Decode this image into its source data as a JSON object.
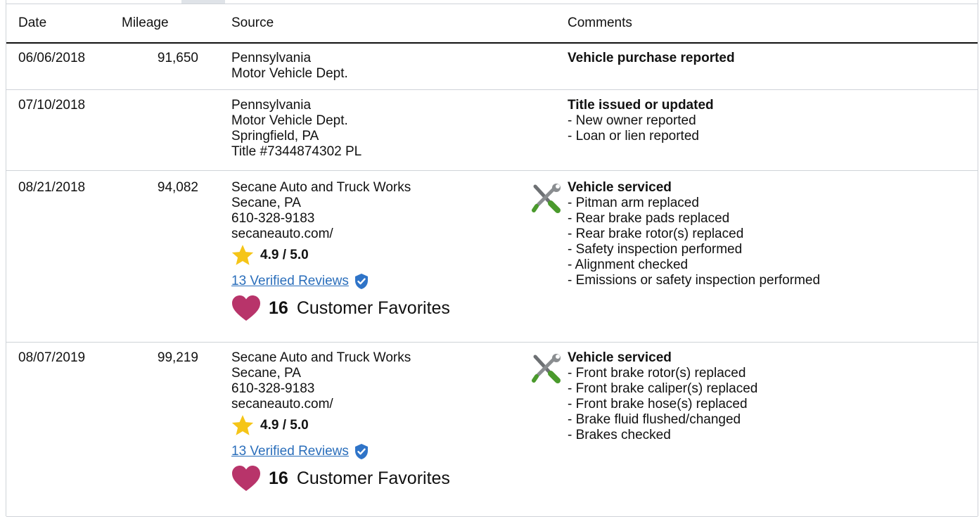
{
  "header": {
    "date": "Date",
    "mileage": "Mileage",
    "source": "Source",
    "comments": "Comments"
  },
  "rows": [
    {
      "date": "06/06/2018",
      "mileage": "91,650",
      "source": [
        "Pennsylvania",
        "Motor Vehicle Dept."
      ],
      "comment_title": "Vehicle purchase reported",
      "comment_items": []
    },
    {
      "date": "07/10/2018",
      "mileage": "",
      "source": [
        "Pennsylvania",
        "Motor Vehicle Dept.",
        "Springfield, PA",
        "Title #7344874302 PL"
      ],
      "comment_title": "Title issued or updated",
      "comment_items": [
        "- New owner reported",
        "- Loan or lien reported"
      ]
    },
    {
      "date": "08/21/2018",
      "mileage": "94,082",
      "source": [
        "Secane Auto and Truck Works",
        "Secane, PA",
        "610-328-9183",
        "secaneauto.com/"
      ],
      "rating": "4.9 / 5.0",
      "reviews": "13 Verified Reviews",
      "favorites_count": "16",
      "favorites_label": "Customer Favorites",
      "comment_title": "Vehicle serviced",
      "comment_items": [
        "- Pitman arm replaced",
        "- Rear brake pads replaced",
        "- Rear brake rotor(s) replaced",
        "- Safety inspection performed",
        "- Alignment checked",
        "- Emissions or safety inspection performed"
      ]
    },
    {
      "date": "08/07/2019",
      "mileage": "99,219",
      "source": [
        "Secane Auto and Truck Works",
        "Secane, PA",
        "610-328-9183",
        "secaneauto.com/"
      ],
      "rating": "4.9 / 5.0",
      "reviews": "13 Verified Reviews",
      "favorites_count": "16",
      "favorites_label": "Customer Favorites",
      "comment_title": "Vehicle serviced",
      "comment_items": [
        "- Front brake rotor(s) replaced",
        "- Front brake caliper(s) replaced",
        "- Front brake hose(s) replaced",
        "- Brake fluid flushed/changed",
        "- Brakes checked"
      ]
    }
  ],
  "icons": {
    "star": "star-icon",
    "verified": "verified-badge-icon",
    "heart": "heart-icon",
    "service": "wrench-screwdriver-icon"
  },
  "colors": {
    "link": "#2a6ebb",
    "star": "#f5c518",
    "heart": "#b8346a",
    "badge": "#2f74c8",
    "border": "#cfd3d8"
  }
}
